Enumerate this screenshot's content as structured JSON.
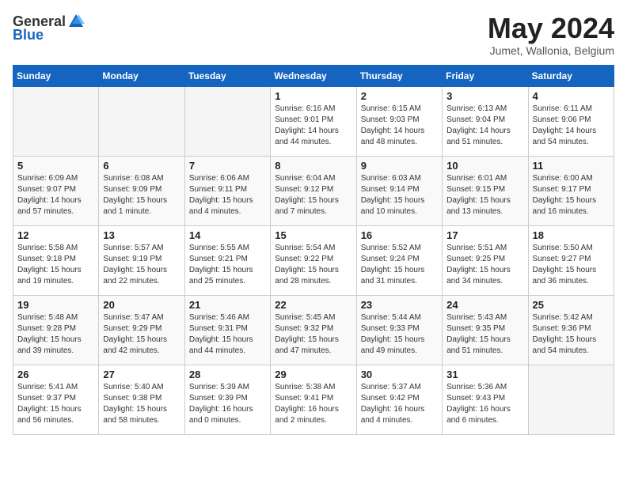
{
  "header": {
    "logo_general": "General",
    "logo_blue": "Blue",
    "title": "May 2024",
    "location": "Jumet, Wallonia, Belgium"
  },
  "weekdays": [
    "Sunday",
    "Monday",
    "Tuesday",
    "Wednesday",
    "Thursday",
    "Friday",
    "Saturday"
  ],
  "weeks": [
    [
      {
        "day": "",
        "info": ""
      },
      {
        "day": "",
        "info": ""
      },
      {
        "day": "",
        "info": ""
      },
      {
        "day": "1",
        "info": "Sunrise: 6:16 AM\nSunset: 9:01 PM\nDaylight: 14 hours\nand 44 minutes."
      },
      {
        "day": "2",
        "info": "Sunrise: 6:15 AM\nSunset: 9:03 PM\nDaylight: 14 hours\nand 48 minutes."
      },
      {
        "day": "3",
        "info": "Sunrise: 6:13 AM\nSunset: 9:04 PM\nDaylight: 14 hours\nand 51 minutes."
      },
      {
        "day": "4",
        "info": "Sunrise: 6:11 AM\nSunset: 9:06 PM\nDaylight: 14 hours\nand 54 minutes."
      }
    ],
    [
      {
        "day": "5",
        "info": "Sunrise: 6:09 AM\nSunset: 9:07 PM\nDaylight: 14 hours\nand 57 minutes."
      },
      {
        "day": "6",
        "info": "Sunrise: 6:08 AM\nSunset: 9:09 PM\nDaylight: 15 hours\nand 1 minute."
      },
      {
        "day": "7",
        "info": "Sunrise: 6:06 AM\nSunset: 9:11 PM\nDaylight: 15 hours\nand 4 minutes."
      },
      {
        "day": "8",
        "info": "Sunrise: 6:04 AM\nSunset: 9:12 PM\nDaylight: 15 hours\nand 7 minutes."
      },
      {
        "day": "9",
        "info": "Sunrise: 6:03 AM\nSunset: 9:14 PM\nDaylight: 15 hours\nand 10 minutes."
      },
      {
        "day": "10",
        "info": "Sunrise: 6:01 AM\nSunset: 9:15 PM\nDaylight: 15 hours\nand 13 minutes."
      },
      {
        "day": "11",
        "info": "Sunrise: 6:00 AM\nSunset: 9:17 PM\nDaylight: 15 hours\nand 16 minutes."
      }
    ],
    [
      {
        "day": "12",
        "info": "Sunrise: 5:58 AM\nSunset: 9:18 PM\nDaylight: 15 hours\nand 19 minutes."
      },
      {
        "day": "13",
        "info": "Sunrise: 5:57 AM\nSunset: 9:19 PM\nDaylight: 15 hours\nand 22 minutes."
      },
      {
        "day": "14",
        "info": "Sunrise: 5:55 AM\nSunset: 9:21 PM\nDaylight: 15 hours\nand 25 minutes."
      },
      {
        "day": "15",
        "info": "Sunrise: 5:54 AM\nSunset: 9:22 PM\nDaylight: 15 hours\nand 28 minutes."
      },
      {
        "day": "16",
        "info": "Sunrise: 5:52 AM\nSunset: 9:24 PM\nDaylight: 15 hours\nand 31 minutes."
      },
      {
        "day": "17",
        "info": "Sunrise: 5:51 AM\nSunset: 9:25 PM\nDaylight: 15 hours\nand 34 minutes."
      },
      {
        "day": "18",
        "info": "Sunrise: 5:50 AM\nSunset: 9:27 PM\nDaylight: 15 hours\nand 36 minutes."
      }
    ],
    [
      {
        "day": "19",
        "info": "Sunrise: 5:48 AM\nSunset: 9:28 PM\nDaylight: 15 hours\nand 39 minutes."
      },
      {
        "day": "20",
        "info": "Sunrise: 5:47 AM\nSunset: 9:29 PM\nDaylight: 15 hours\nand 42 minutes."
      },
      {
        "day": "21",
        "info": "Sunrise: 5:46 AM\nSunset: 9:31 PM\nDaylight: 15 hours\nand 44 minutes."
      },
      {
        "day": "22",
        "info": "Sunrise: 5:45 AM\nSunset: 9:32 PM\nDaylight: 15 hours\nand 47 minutes."
      },
      {
        "day": "23",
        "info": "Sunrise: 5:44 AM\nSunset: 9:33 PM\nDaylight: 15 hours\nand 49 minutes."
      },
      {
        "day": "24",
        "info": "Sunrise: 5:43 AM\nSunset: 9:35 PM\nDaylight: 15 hours\nand 51 minutes."
      },
      {
        "day": "25",
        "info": "Sunrise: 5:42 AM\nSunset: 9:36 PM\nDaylight: 15 hours\nand 54 minutes."
      }
    ],
    [
      {
        "day": "26",
        "info": "Sunrise: 5:41 AM\nSunset: 9:37 PM\nDaylight: 15 hours\nand 56 minutes."
      },
      {
        "day": "27",
        "info": "Sunrise: 5:40 AM\nSunset: 9:38 PM\nDaylight: 15 hours\nand 58 minutes."
      },
      {
        "day": "28",
        "info": "Sunrise: 5:39 AM\nSunset: 9:39 PM\nDaylight: 16 hours\nand 0 minutes."
      },
      {
        "day": "29",
        "info": "Sunrise: 5:38 AM\nSunset: 9:41 PM\nDaylight: 16 hours\nand 2 minutes."
      },
      {
        "day": "30",
        "info": "Sunrise: 5:37 AM\nSunset: 9:42 PM\nDaylight: 16 hours\nand 4 minutes."
      },
      {
        "day": "31",
        "info": "Sunrise: 5:36 AM\nSunset: 9:43 PM\nDaylight: 16 hours\nand 6 minutes."
      },
      {
        "day": "",
        "info": ""
      }
    ]
  ]
}
